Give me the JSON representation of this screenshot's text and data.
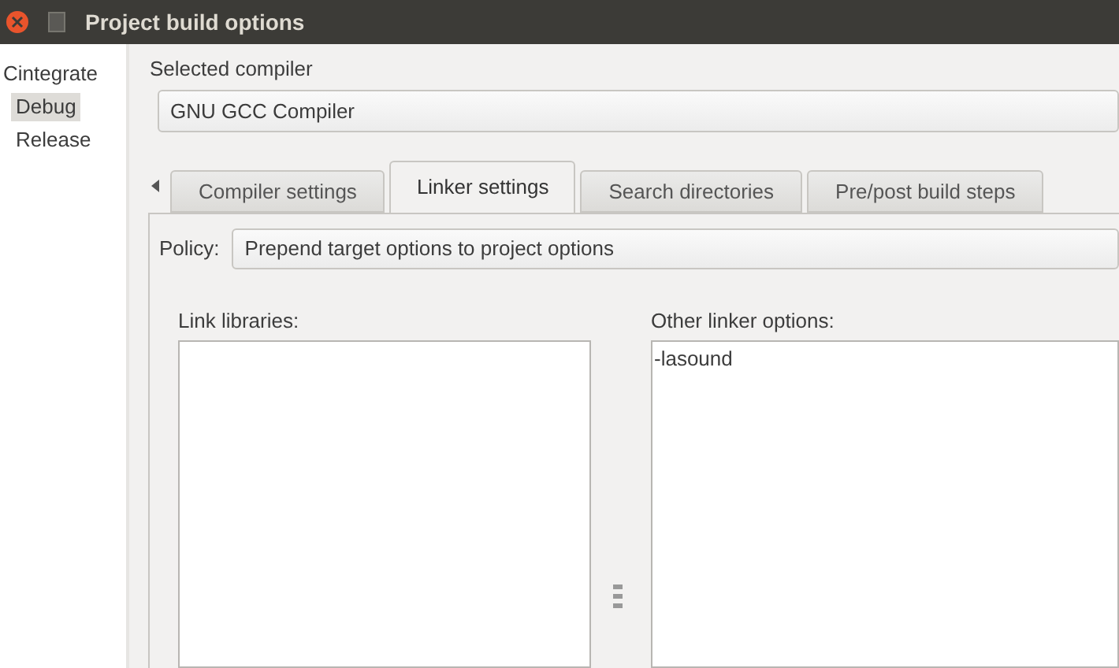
{
  "window": {
    "title": "Project build options"
  },
  "targets": [
    {
      "label": "Cintegrate",
      "selected": false
    },
    {
      "label": "Debug",
      "selected": true
    },
    {
      "label": "Release",
      "selected": false
    }
  ],
  "compiler": {
    "label": "Selected compiler",
    "value": "GNU GCC Compiler"
  },
  "tabs": [
    {
      "label": "Compiler settings",
      "selected": false
    },
    {
      "label": "Linker settings",
      "selected": true
    },
    {
      "label": "Search directories",
      "selected": false
    },
    {
      "label": "Pre/post build steps",
      "selected": false
    }
  ],
  "policy": {
    "label": "Policy:",
    "value": "Prepend target options to project options"
  },
  "link_libraries": {
    "label": "Link libraries:"
  },
  "other_linker_options": {
    "label": "Other linker options:",
    "value": "-lasound"
  }
}
